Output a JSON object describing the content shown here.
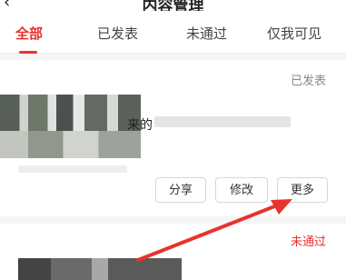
{
  "header": {
    "title": "内容管理",
    "back_icon": "chevron-left-icon"
  },
  "tabs": [
    {
      "label": "全部",
      "active": true
    },
    {
      "label": "已发表",
      "active": false
    },
    {
      "label": "未通过",
      "active": false
    },
    {
      "label": "仅我可见",
      "active": false
    }
  ],
  "colors": {
    "accent": "#e8322d",
    "annotation_arrow": "#e8322d"
  },
  "post1": {
    "status": "已发表",
    "title_fragment": "来的",
    "actions": {
      "share": "分享",
      "edit": "修改",
      "more": "更多"
    }
  },
  "post2": {
    "status": "未通过"
  }
}
